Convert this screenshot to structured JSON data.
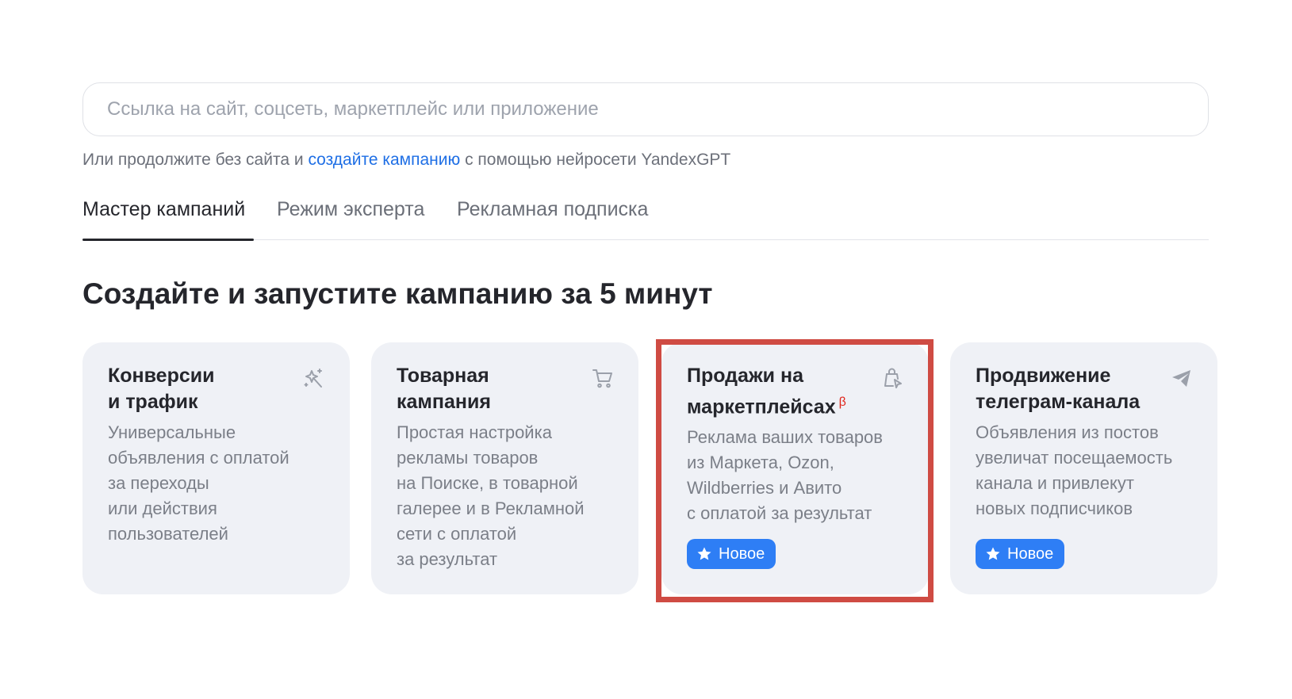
{
  "search": {
    "placeholder": "Ссылка на сайт, соцсеть, маркетплейс или приложение"
  },
  "hint": {
    "before": "Или продолжите без сайта и ",
    "link": "создайте кампанию",
    "after": " с помощью нейросети YandexGPT"
  },
  "tabs": [
    {
      "label": "Мастер кампаний",
      "active": true
    },
    {
      "label": "Режим эксперта",
      "active": false
    },
    {
      "label": "Рекламная подписка",
      "active": false
    }
  ],
  "heading": "Создайте и запустите кампанию за 5 минут",
  "cards": [
    {
      "title": "Конверсии\nи трафик",
      "description": "Универсальные\nобъявления с оплатой\nза переходы\nили действия\nпользователей",
      "icon": "magic-sparkle-icon"
    },
    {
      "title": "Товарная\nкампания",
      "description": "Простая настройка\nрекламы товаров\nна Поиске, в товарной\nгалерее и в Рекламной\nсети с оплатой\nза результат",
      "icon": "cart-icon"
    },
    {
      "title": "Продажи на\nмаркетплейсах",
      "beta": "β",
      "description": "Реклама ваших товаров\nиз Маркета, Ozon,\nWildberries и Авито\nс оплатой за результат",
      "icon": "shopping-bag-click-icon",
      "badge": "Новое",
      "highlighted": true
    },
    {
      "title": "Продвижение\nтелеграм-канала",
      "description": "Объявления из постов\nувеличат посещаемость\nканала и привлекут\nновых подписчиков",
      "icon": "telegram-plane-icon",
      "badge": "Новое"
    }
  ],
  "colors": {
    "accent": "#1f6fe5",
    "badge": "#2e7ef5",
    "card_bg": "#eff1f6",
    "highlight_border": "#cf4b43",
    "beta": "#e0261c"
  }
}
